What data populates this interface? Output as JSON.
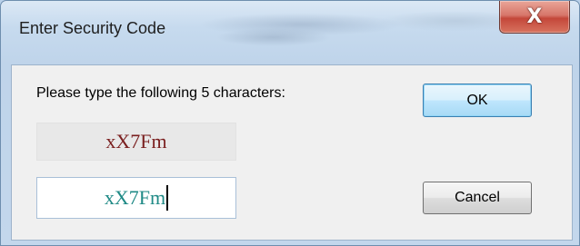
{
  "window": {
    "title": "Enter Security Code",
    "close_icon": "close-icon",
    "close_glyph": "X"
  },
  "dialog": {
    "prompt": "Please type the following 5 characters:",
    "security_code": "xX7Fm",
    "input_value": "xX7Fm",
    "ok_label": "OK",
    "cancel_label": "Cancel"
  },
  "colors": {
    "code_display_text": "#7a1f1f",
    "input_text": "#1f8a86",
    "close_button": "#c4473a"
  }
}
